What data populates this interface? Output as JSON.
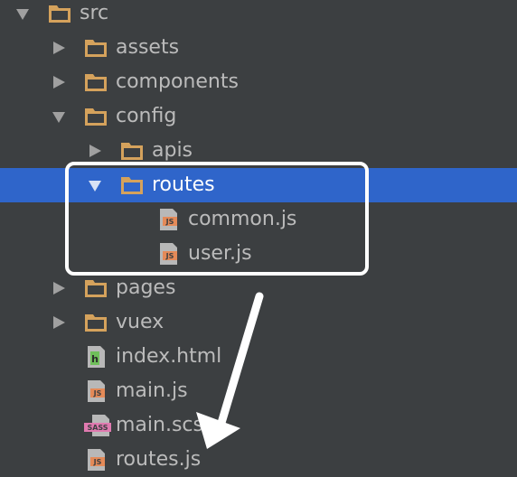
{
  "colors": {
    "background": "#3c3f41",
    "selection": "#2f65ca",
    "text": "#bbbbbb",
    "folder": "#d5a25c",
    "js_badge": "#e48a58",
    "html_badge": "#6fbf5a",
    "sass_badge": "#e07ab0"
  },
  "tree": {
    "items": [
      {
        "label": "src",
        "kind": "folder",
        "arrow": "expanded",
        "icon": "folder-icon"
      },
      {
        "label": "assets",
        "kind": "folder",
        "arrow": "collapsed",
        "icon": "folder-icon"
      },
      {
        "label": "components",
        "kind": "folder",
        "arrow": "collapsed",
        "icon": "folder-icon"
      },
      {
        "label": "config",
        "kind": "folder",
        "arrow": "expanded",
        "icon": "folder-icon"
      },
      {
        "label": "apis",
        "kind": "folder",
        "arrow": "collapsed",
        "icon": "folder-icon"
      },
      {
        "label": "routes",
        "kind": "folder",
        "arrow": "expanded",
        "icon": "folder-icon",
        "selected": true
      },
      {
        "label": "common.js",
        "kind": "file",
        "badge": "JS",
        "icon": "js-file-icon"
      },
      {
        "label": "user.js",
        "kind": "file",
        "badge": "JS",
        "icon": "js-file-icon"
      },
      {
        "label": "pages",
        "kind": "folder",
        "arrow": "collapsed",
        "icon": "folder-icon"
      },
      {
        "label": "vuex",
        "kind": "folder",
        "arrow": "collapsed",
        "icon": "folder-icon"
      },
      {
        "label": "index.html",
        "kind": "file",
        "badge": "h",
        "icon": "html-file-icon"
      },
      {
        "label": "main.js",
        "kind": "file",
        "badge": "JS",
        "icon": "js-file-icon"
      },
      {
        "label": "main.scss",
        "kind": "file",
        "badge": "SASS",
        "icon": "sass-file-icon"
      },
      {
        "label": "routes.js",
        "kind": "file",
        "badge": "JS",
        "icon": "js-file-icon"
      }
    ]
  }
}
